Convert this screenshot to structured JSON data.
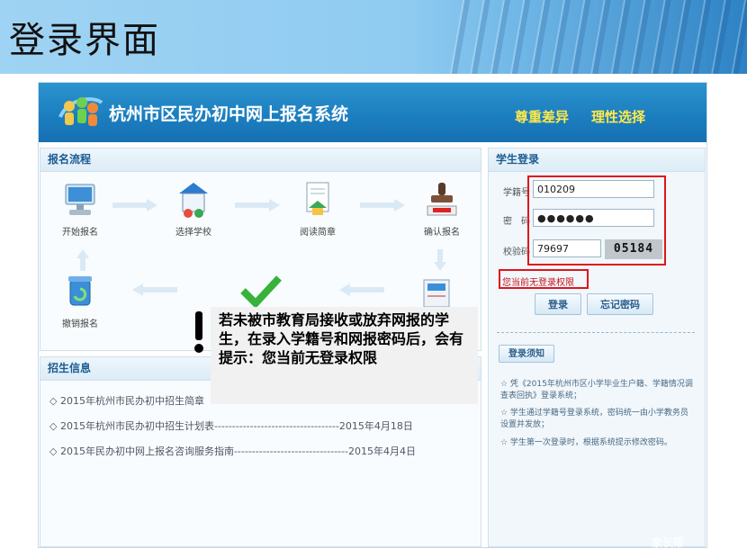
{
  "slide": {
    "title": "登录界面"
  },
  "site": {
    "name": "杭州市区民办初中网上报名系统",
    "slogans": [
      "尊重差异",
      "理性选择"
    ]
  },
  "process": {
    "header": "报名流程",
    "steps": [
      "开始报名",
      "选择学校",
      "阅读简章",
      "确认报名",
      "撤销报名"
    ]
  },
  "info": {
    "header": "招生信息",
    "items": [
      "◇ 2015年杭州市民办初中招生简章",
      "◇ 2015年杭州市民办初中招生计划表-----------------------------------2015年4月18日",
      "◇ 2015年民办初中网上报名咨询服务指南--------------------------------2015年4月4日"
    ]
  },
  "login": {
    "header": "学生登录",
    "student_id_label": "学籍号",
    "student_id_value": "010209",
    "password_label": "密　码",
    "password_value": "●●●●●●",
    "captcha_label": "校验码",
    "captcha_value": "79697",
    "captcha_image_text": "05184",
    "notice": "您当前无登录权限",
    "login_button": "登录",
    "forgot_button": "忘记密码",
    "tips_button": "登录须知",
    "tips": [
      "☆ 凭《2015年杭州市区小学毕业生户籍、学籍情况调查表回执》登录系统；",
      "☆ 学生通过学籍号登录系统，密码统一由小学教务员设置并发放；",
      "☆ 学生第一次登录时，根据系统提示修改密码。"
    ]
  },
  "callout": {
    "text": "若未被市教育局接收或放弃网报的学生，在录入学籍号和网报密码后，会有提示：您当前无登录权限"
  },
  "watermark": "家长帮",
  "colors": {
    "banner": "#1b7dbe",
    "slogan": "#ffe94a",
    "highlight": "#e0141b"
  }
}
